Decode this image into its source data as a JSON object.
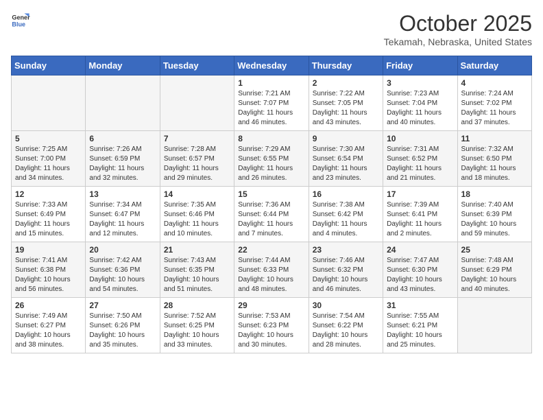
{
  "header": {
    "logo": {
      "general": "General",
      "blue": "Blue"
    },
    "title": "October 2025",
    "location": "Tekamah, Nebraska, United States"
  },
  "calendar": {
    "weekdays": [
      "Sunday",
      "Monday",
      "Tuesday",
      "Wednesday",
      "Thursday",
      "Friday",
      "Saturday"
    ],
    "weeks": [
      [
        {
          "day": "",
          "info": ""
        },
        {
          "day": "",
          "info": ""
        },
        {
          "day": "",
          "info": ""
        },
        {
          "day": "1",
          "info": "Sunrise: 7:21 AM\nSunset: 7:07 PM\nDaylight: 11 hours\nand 46 minutes."
        },
        {
          "day": "2",
          "info": "Sunrise: 7:22 AM\nSunset: 7:05 PM\nDaylight: 11 hours\nand 43 minutes."
        },
        {
          "day": "3",
          "info": "Sunrise: 7:23 AM\nSunset: 7:04 PM\nDaylight: 11 hours\nand 40 minutes."
        },
        {
          "day": "4",
          "info": "Sunrise: 7:24 AM\nSunset: 7:02 PM\nDaylight: 11 hours\nand 37 minutes."
        }
      ],
      [
        {
          "day": "5",
          "info": "Sunrise: 7:25 AM\nSunset: 7:00 PM\nDaylight: 11 hours\nand 34 minutes."
        },
        {
          "day": "6",
          "info": "Sunrise: 7:26 AM\nSunset: 6:59 PM\nDaylight: 11 hours\nand 32 minutes."
        },
        {
          "day": "7",
          "info": "Sunrise: 7:28 AM\nSunset: 6:57 PM\nDaylight: 11 hours\nand 29 minutes."
        },
        {
          "day": "8",
          "info": "Sunrise: 7:29 AM\nSunset: 6:55 PM\nDaylight: 11 hours\nand 26 minutes."
        },
        {
          "day": "9",
          "info": "Sunrise: 7:30 AM\nSunset: 6:54 PM\nDaylight: 11 hours\nand 23 minutes."
        },
        {
          "day": "10",
          "info": "Sunrise: 7:31 AM\nSunset: 6:52 PM\nDaylight: 11 hours\nand 21 minutes."
        },
        {
          "day": "11",
          "info": "Sunrise: 7:32 AM\nSunset: 6:50 PM\nDaylight: 11 hours\nand 18 minutes."
        }
      ],
      [
        {
          "day": "12",
          "info": "Sunrise: 7:33 AM\nSunset: 6:49 PM\nDaylight: 11 hours\nand 15 minutes."
        },
        {
          "day": "13",
          "info": "Sunrise: 7:34 AM\nSunset: 6:47 PM\nDaylight: 11 hours\nand 12 minutes."
        },
        {
          "day": "14",
          "info": "Sunrise: 7:35 AM\nSunset: 6:46 PM\nDaylight: 11 hours\nand 10 minutes."
        },
        {
          "day": "15",
          "info": "Sunrise: 7:36 AM\nSunset: 6:44 PM\nDaylight: 11 hours\nand 7 minutes."
        },
        {
          "day": "16",
          "info": "Sunrise: 7:38 AM\nSunset: 6:42 PM\nDaylight: 11 hours\nand 4 minutes."
        },
        {
          "day": "17",
          "info": "Sunrise: 7:39 AM\nSunset: 6:41 PM\nDaylight: 11 hours\nand 2 minutes."
        },
        {
          "day": "18",
          "info": "Sunrise: 7:40 AM\nSunset: 6:39 PM\nDaylight: 10 hours\nand 59 minutes."
        }
      ],
      [
        {
          "day": "19",
          "info": "Sunrise: 7:41 AM\nSunset: 6:38 PM\nDaylight: 10 hours\nand 56 minutes."
        },
        {
          "day": "20",
          "info": "Sunrise: 7:42 AM\nSunset: 6:36 PM\nDaylight: 10 hours\nand 54 minutes."
        },
        {
          "day": "21",
          "info": "Sunrise: 7:43 AM\nSunset: 6:35 PM\nDaylight: 10 hours\nand 51 minutes."
        },
        {
          "day": "22",
          "info": "Sunrise: 7:44 AM\nSunset: 6:33 PM\nDaylight: 10 hours\nand 48 minutes."
        },
        {
          "day": "23",
          "info": "Sunrise: 7:46 AM\nSunset: 6:32 PM\nDaylight: 10 hours\nand 46 minutes."
        },
        {
          "day": "24",
          "info": "Sunrise: 7:47 AM\nSunset: 6:30 PM\nDaylight: 10 hours\nand 43 minutes."
        },
        {
          "day": "25",
          "info": "Sunrise: 7:48 AM\nSunset: 6:29 PM\nDaylight: 10 hours\nand 40 minutes."
        }
      ],
      [
        {
          "day": "26",
          "info": "Sunrise: 7:49 AM\nSunset: 6:27 PM\nDaylight: 10 hours\nand 38 minutes."
        },
        {
          "day": "27",
          "info": "Sunrise: 7:50 AM\nSunset: 6:26 PM\nDaylight: 10 hours\nand 35 minutes."
        },
        {
          "day": "28",
          "info": "Sunrise: 7:52 AM\nSunset: 6:25 PM\nDaylight: 10 hours\nand 33 minutes."
        },
        {
          "day": "29",
          "info": "Sunrise: 7:53 AM\nSunset: 6:23 PM\nDaylight: 10 hours\nand 30 minutes."
        },
        {
          "day": "30",
          "info": "Sunrise: 7:54 AM\nSunset: 6:22 PM\nDaylight: 10 hours\nand 28 minutes."
        },
        {
          "day": "31",
          "info": "Sunrise: 7:55 AM\nSunset: 6:21 PM\nDaylight: 10 hours\nand 25 minutes."
        },
        {
          "day": "",
          "info": ""
        }
      ]
    ]
  }
}
